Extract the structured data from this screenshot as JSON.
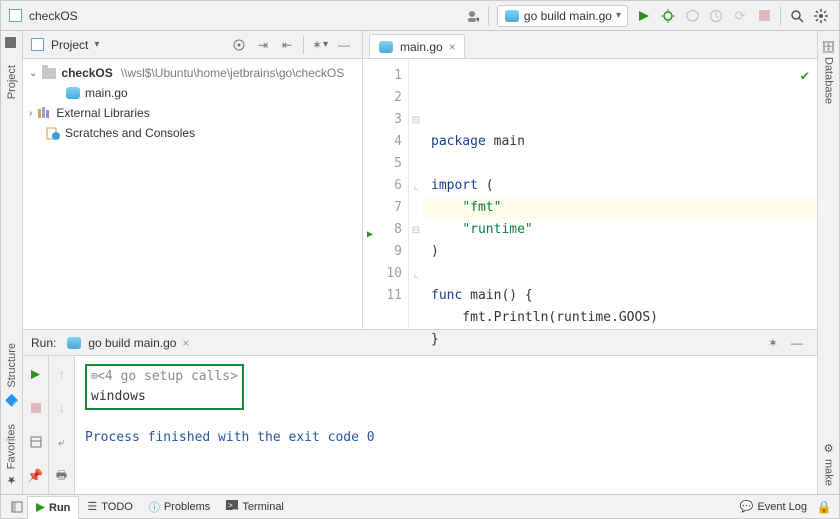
{
  "window_title": "checkOS",
  "toolbar": {
    "run_config": "go build main.go"
  },
  "project_panel": {
    "title": "Project",
    "root": {
      "name": "checkOS",
      "path": "\\\\wsl$\\Ubuntu\\home\\jetbrains\\go\\checkOS"
    },
    "file": "main.go",
    "external_libs": "External Libraries",
    "scratches": "Scratches and Consoles"
  },
  "editor": {
    "tab_label": "main.go",
    "lines": [
      {
        "n": 1,
        "frag": [
          [
            "kw",
            "package "
          ],
          [
            "id",
            "main"
          ]
        ]
      },
      {
        "n": 2,
        "frag": []
      },
      {
        "n": 3,
        "frag": [
          [
            "kw",
            "import "
          ],
          [
            "id",
            "("
          ]
        ]
      },
      {
        "n": 4,
        "frag": [
          [
            "id",
            "    "
          ],
          [
            "str",
            "\"fmt\""
          ]
        ]
      },
      {
        "n": 5,
        "frag": [
          [
            "id",
            "    "
          ],
          [
            "str",
            "\"runtime\""
          ]
        ]
      },
      {
        "n": 6,
        "frag": [
          [
            "id",
            ")"
          ]
        ]
      },
      {
        "n": 7,
        "frag": [],
        "hl": true
      },
      {
        "n": 8,
        "frag": [
          [
            "kw",
            "func "
          ],
          [
            "fn",
            "main"
          ],
          [
            "id",
            "() {"
          ]
        ],
        "run": true
      },
      {
        "n": 9,
        "frag": [
          [
            "id",
            "    fmt.Println(runtime."
          ],
          [
            "id",
            "GOOS"
          ],
          [
            "id",
            ")"
          ]
        ]
      },
      {
        "n": 10,
        "frag": [
          [
            "id",
            "}"
          ]
        ]
      },
      {
        "n": 11,
        "frag": []
      }
    ]
  },
  "run_panel": {
    "label": "Run:",
    "config_tab": "go build main.go",
    "highlighted": {
      "calls": "<4 go setup calls>",
      "output": "windows"
    },
    "exit": "Process finished with the exit code 0"
  },
  "sidebars": {
    "left": {
      "project": "Project",
      "structure": "Structure",
      "favorites": "Favorites"
    },
    "right": {
      "database": "Database",
      "make": "make"
    }
  },
  "statusbar": {
    "run": "Run",
    "todo": "TODO",
    "problems": "Problems",
    "terminal": "Terminal",
    "event_log": "Event Log"
  }
}
